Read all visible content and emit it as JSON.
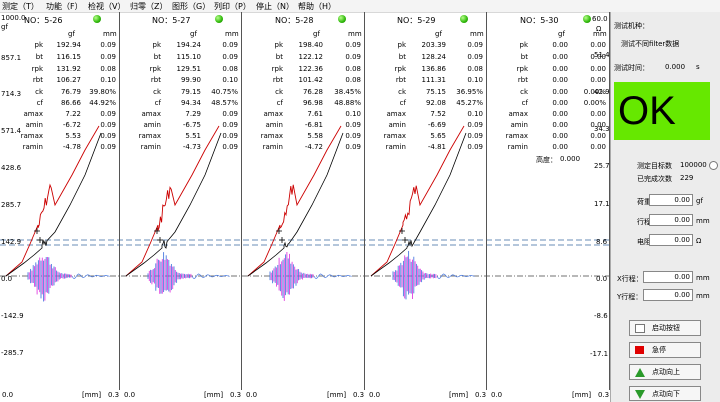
{
  "menu": [
    "测定（T）",
    "功能（F）",
    "检视（V）",
    "归零（Z）",
    "图形（G）",
    "列印（P）",
    "停止（N）",
    "帮助（H）"
  ],
  "y_axis_left": {
    "unit_top": "1000.0",
    "unit_label": "gf",
    "ticks": [
      "857.1",
      "714.3",
      "571.4",
      "428.6",
      "285.7",
      "142.9",
      "0.0",
      "-142.9",
      "-285.7"
    ]
  },
  "y_axis_right": {
    "top": "60.0",
    "unit": "Ω",
    "ticks": [
      "51.4",
      "42.9",
      "34.3",
      "25.7",
      "17.1",
      "8.6",
      "0.0",
      "-8.6",
      "-17.1"
    ]
  },
  "x_axis": {
    "start": "0.0",
    "unit": "[mm]",
    "end": "0.3"
  },
  "column_headers": {
    "gf": "gf",
    "mm": "mm"
  },
  "panels": [
    {
      "title": "NO：5-26",
      "rows": [
        [
          "pk",
          "192.94",
          "0.09"
        ],
        [
          "bt",
          "116.15",
          "0.09"
        ],
        [
          "rpk",
          "131.92",
          "0.08"
        ],
        [
          "rbt",
          "106.27",
          "0.10"
        ],
        [
          "ck",
          "76.79",
          "39.80%"
        ],
        [
          "cf",
          "86.66",
          "44.92%"
        ],
        [
          "amax",
          "7.22",
          "0.09"
        ],
        [
          "amin",
          "-6.72",
          "0.09"
        ],
        [
          "ramax",
          "5.53",
          "0.09"
        ],
        [
          "ramin",
          "-4.78",
          "0.09"
        ]
      ]
    },
    {
      "title": "NO：5-27",
      "rows": [
        [
          "pk",
          "194.24",
          "0.09"
        ],
        [
          "bt",
          "115.10",
          "0.09"
        ],
        [
          "rpk",
          "129.51",
          "0.08"
        ],
        [
          "rbt",
          "99.90",
          "0.10"
        ],
        [
          "ck",
          "79.15",
          "40.75%"
        ],
        [
          "cf",
          "94.34",
          "48.57%"
        ],
        [
          "amax",
          "7.29",
          "0.09"
        ],
        [
          "amin",
          "-6.75",
          "0.09"
        ],
        [
          "ramax",
          "5.51",
          "0.09"
        ],
        [
          "ramin",
          "-4.73",
          "0.09"
        ]
      ]
    },
    {
      "title": "NO：5-28",
      "rows": [
        [
          "pk",
          "198.40",
          "0.09"
        ],
        [
          "bt",
          "122.12",
          "0.09"
        ],
        [
          "rpk",
          "122.36",
          "0.08"
        ],
        [
          "rbt",
          "101.42",
          "0.08"
        ],
        [
          "ck",
          "76.28",
          "38.45%"
        ],
        [
          "cf",
          "96.98",
          "48.88%"
        ],
        [
          "amax",
          "7.61",
          "0.10"
        ],
        [
          "amin",
          "-6.81",
          "0.09"
        ],
        [
          "ramax",
          "5.58",
          "0.09"
        ],
        [
          "ramin",
          "-4.72",
          "0.09"
        ]
      ]
    },
    {
      "title": "NO：5-29",
      "rows": [
        [
          "pk",
          "203.39",
          "0.09"
        ],
        [
          "bt",
          "128.24",
          "0.09"
        ],
        [
          "rpk",
          "136.86",
          "0.08"
        ],
        [
          "rbt",
          "111.31",
          "0.10"
        ],
        [
          "ck",
          "75.15",
          "36.95%"
        ],
        [
          "cf",
          "92.08",
          "45.27%"
        ],
        [
          "amax",
          "7.52",
          "0.10"
        ],
        [
          "amin",
          "-6.69",
          "0.09"
        ],
        [
          "ramax",
          "5.65",
          "0.09"
        ],
        [
          "ramin",
          "-4.81",
          "0.09"
        ]
      ]
    },
    {
      "title": "NO：5-30",
      "rows": [
        [
          "pk",
          "0.00",
          "0.00"
        ],
        [
          "bt",
          "0.00",
          "0.00"
        ],
        [
          "rpk",
          "0.00",
          "0.00"
        ],
        [
          "rbt",
          "0.00",
          "0.00"
        ],
        [
          "ck",
          "0.00",
          "0.00%"
        ],
        [
          "cf",
          "0.00",
          "0.00%"
        ],
        [
          "amax",
          "0.00",
          "0.00"
        ],
        [
          "amin",
          "0.00",
          "0.00"
        ],
        [
          "ramax",
          "0.00",
          "0.00"
        ],
        [
          "ramin",
          "0.00",
          "0.00"
        ]
      ]
    }
  ],
  "height_readout": {
    "label": "高度：",
    "value": "0.000"
  },
  "sidebar": {
    "machine_label": "测试机种：",
    "machine_value": "测试不同filter数据",
    "time_label": "测试时间：",
    "time_value": "0.000",
    "time_unit": "s",
    "result": "OK",
    "target_label": "测定目标数",
    "target_value": "100000",
    "done_label": "已完成次数",
    "done_value": "229",
    "load_label": "荷重：",
    "load_value": "0.00",
    "load_unit": "gf",
    "stroke_label": "行程：",
    "stroke_value": "0.00",
    "stroke_unit": "mm",
    "resist_label": "电阻：",
    "resist_value": "0.00",
    "resist_unit": "Ω",
    "x_label": "X行程：",
    "x_value": "0.00",
    "x_unit": "mm",
    "y_label": "Y行程：",
    "y_value": "0.00",
    "y_unit": "mm",
    "buttons": [
      "启动按钮",
      "急停",
      "点动向上",
      "点动向下"
    ]
  },
  "colors": {
    "ok": "#66e800",
    "force_curve": "#cc0000",
    "return_curve": "#000000",
    "ref_line": "#3a6aa0",
    "spike_magenta": "#e040e0",
    "spike_blue": "#4a7ae0"
  }
}
